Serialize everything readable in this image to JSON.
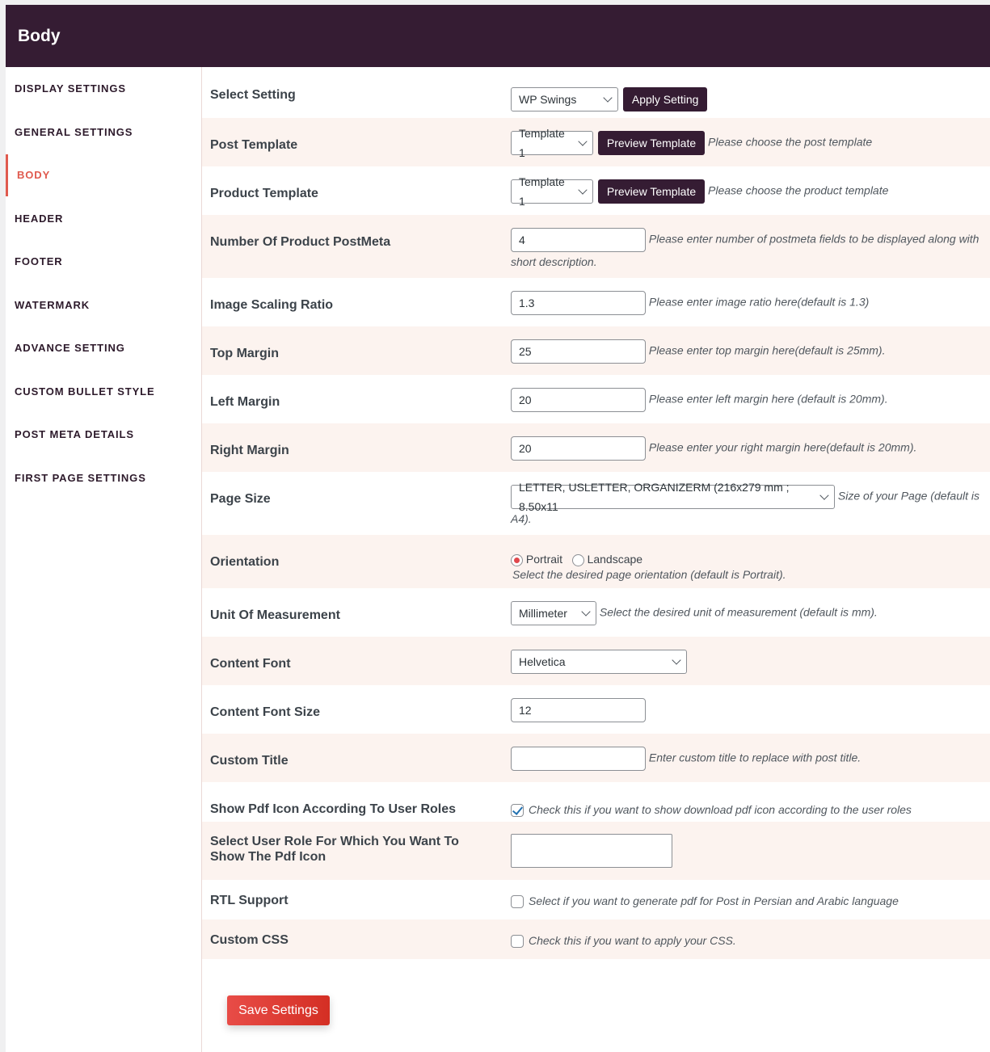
{
  "header": {
    "title": "Body"
  },
  "sidebar": {
    "items": [
      {
        "label": "DISPLAY SETTINGS",
        "active": false
      },
      {
        "label": "GENERAL SETTINGS",
        "active": false
      },
      {
        "label": "BODY",
        "active": true
      },
      {
        "label": "HEADER",
        "active": false
      },
      {
        "label": "FOOTER",
        "active": false
      },
      {
        "label": "WATERMARK",
        "active": false
      },
      {
        "label": "ADVANCE SETTING",
        "active": false
      },
      {
        "label": "CUSTOM BULLET STYLE",
        "active": false
      },
      {
        "label": "POST META DETAILS",
        "active": false
      },
      {
        "label": "FIRST PAGE SETTINGS",
        "active": false
      }
    ]
  },
  "form": {
    "select_setting": {
      "label": "Select Setting",
      "value": "WP Swings",
      "button": "Apply Setting"
    },
    "post_template": {
      "label": "Post Template",
      "value": "Template 1",
      "button": "Preview Template",
      "desc": "Please choose the post template"
    },
    "product_template": {
      "label": "Product Template",
      "value": "Template 1",
      "button": "Preview Template",
      "desc": "Please choose the product template"
    },
    "postmeta": {
      "label": "Number Of Product PostMeta",
      "value": "4",
      "desc": "Please enter number of postmeta fields to be displayed along with short description."
    },
    "image_ratio": {
      "label": "Image Scaling Ratio",
      "value": "1.3",
      "desc": "Please enter image ratio here(default is 1.3)"
    },
    "top_margin": {
      "label": "Top Margin",
      "value": "25",
      "desc": "Please enter top margin here(default is 25mm)."
    },
    "left_margin": {
      "label": "Left Margin",
      "value": "20",
      "desc": "Please enter left margin here (default is 20mm)."
    },
    "right_margin": {
      "label": "Right Margin",
      "value": "20",
      "desc": "Please enter your right margin here(default is 20mm)."
    },
    "page_size": {
      "label": "Page Size",
      "value": "LETTER, USLETTER, ORGANIZERM (216x279 mm ; 8.50x11",
      "desc": "Size of your Page (default is A4)."
    },
    "orientation": {
      "label": "Orientation",
      "options": [
        "Portrait",
        "Landscape"
      ],
      "selected": "Portrait",
      "desc": "Select the desired page orientation (default is Portrait)."
    },
    "unit": {
      "label": "Unit Of Measurement",
      "value": "Millimeter",
      "desc": "Select the desired unit of measurement (default is mm)."
    },
    "content_font": {
      "label": "Content Font",
      "value": "Helvetica"
    },
    "content_font_size": {
      "label": "Content Font Size",
      "value": "12"
    },
    "custom_title": {
      "label": "Custom Title",
      "value": "",
      "desc": "Enter custom title to replace with post title."
    },
    "show_pdf_icon": {
      "label": "Show Pdf Icon According To User Roles",
      "checked": true,
      "desc": "Check this if you want to show download pdf icon according to the user roles"
    },
    "user_role": {
      "label": "Select User Role For Which You Want To Show The Pdf Icon",
      "value": ""
    },
    "rtl": {
      "label": "RTL Support",
      "checked": false,
      "desc": "Select if you want to generate pdf for Post in Persian and Arabic language"
    },
    "custom_css": {
      "label": "Custom CSS",
      "checked": false,
      "desc": "Check this if you want to apply your CSS."
    }
  },
  "save_button": "Save Settings"
}
